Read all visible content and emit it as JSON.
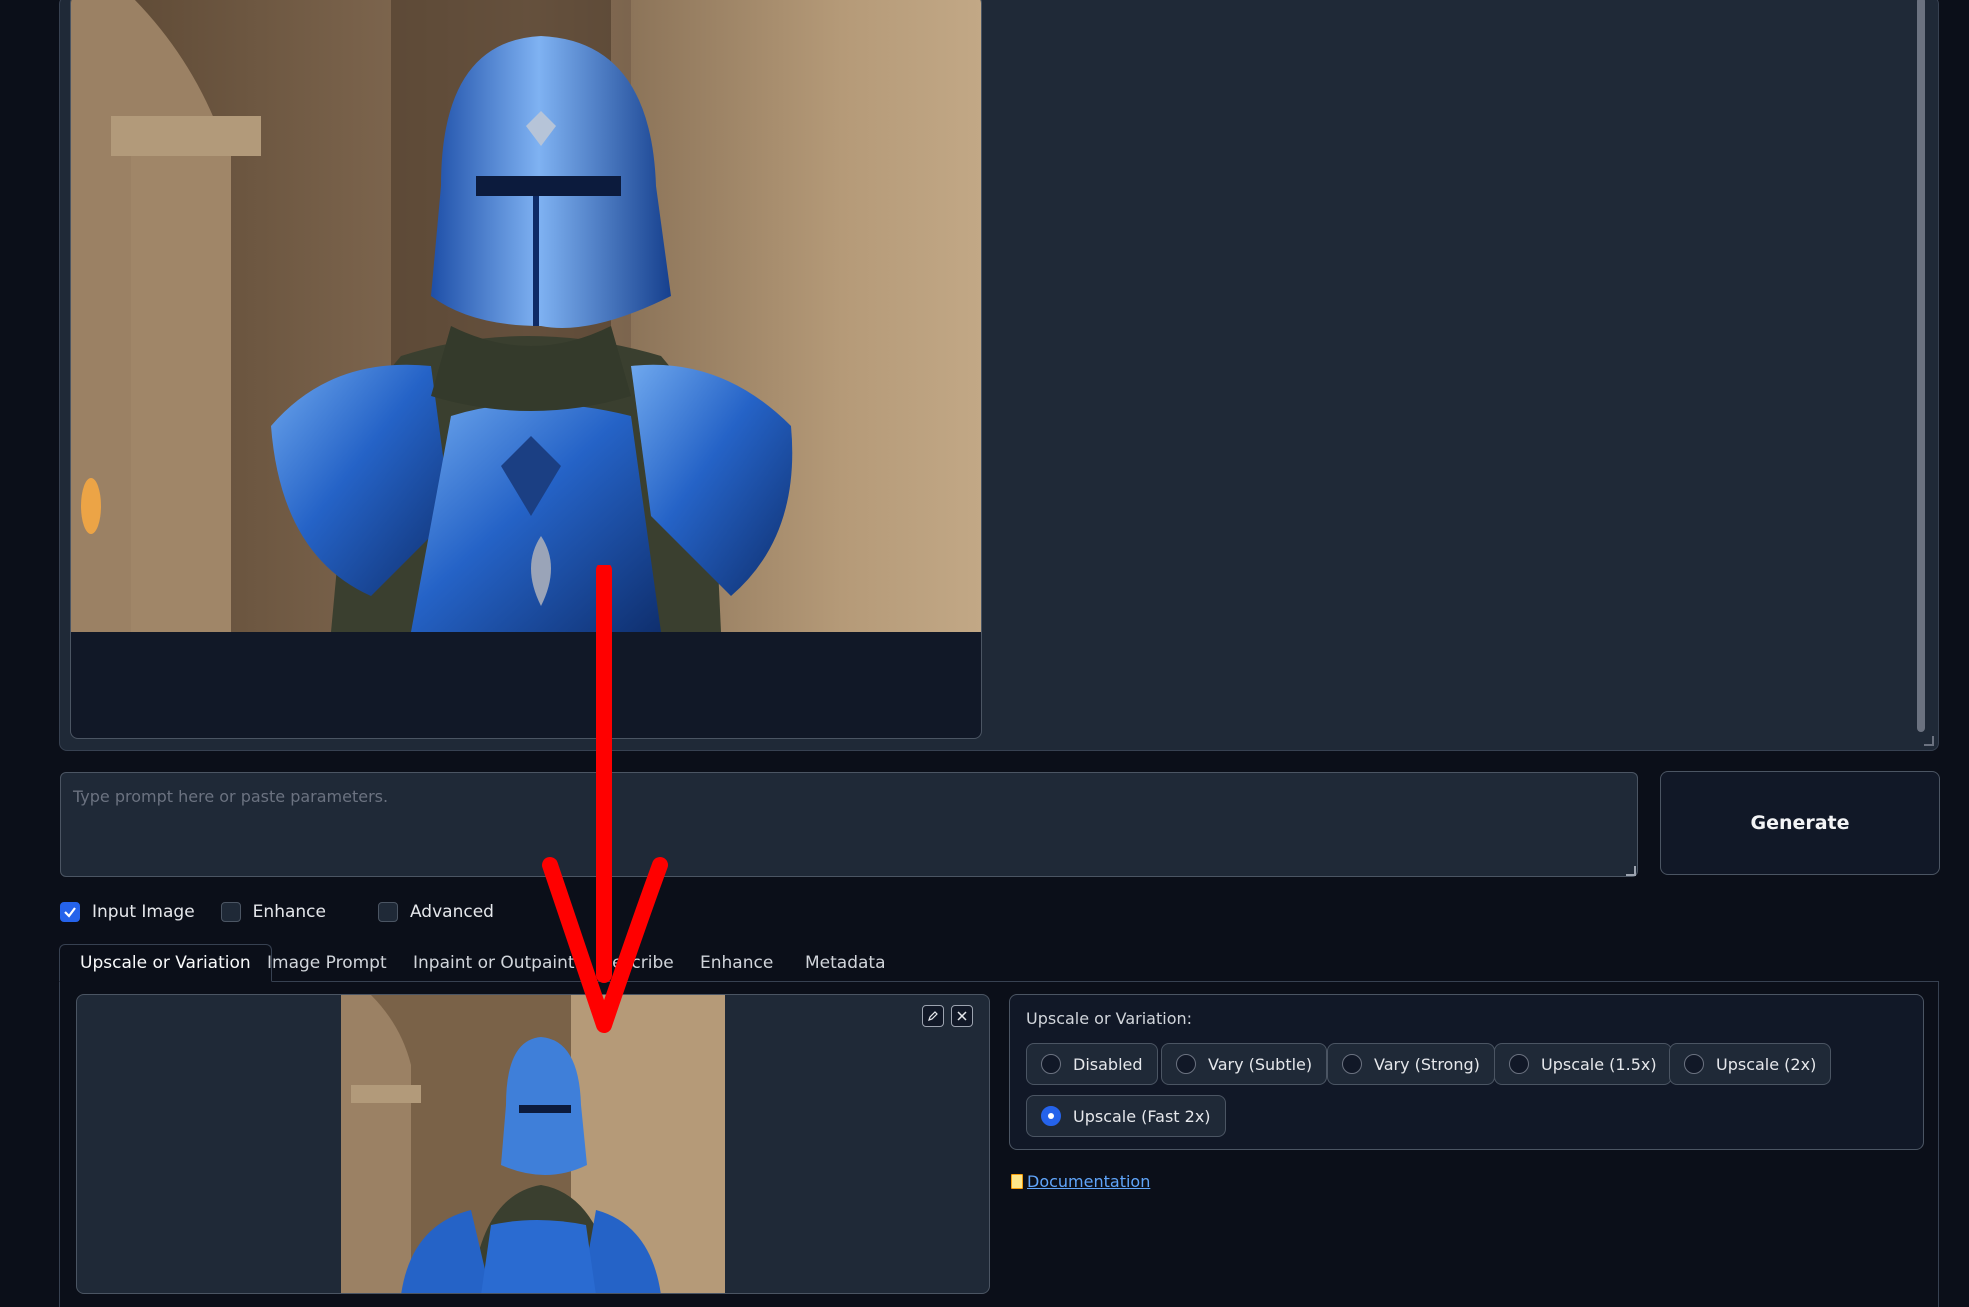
{
  "prompt": {
    "placeholder": "Type prompt here or paste parameters.",
    "value": ""
  },
  "generate": {
    "label": "Generate"
  },
  "options": [
    {
      "label": "Input Image",
      "checked": true
    },
    {
      "label": "Enhance",
      "checked": false
    },
    {
      "label": "Advanced",
      "checked": false
    }
  ],
  "tabs": [
    {
      "label": "Upscale or Variation",
      "active": true
    },
    {
      "label": "Image Prompt",
      "active": false
    },
    {
      "label": "Inpaint or Outpaint",
      "active": false
    },
    {
      "label": "Describe",
      "active": false
    },
    {
      "label": "Enhance",
      "active": false
    },
    {
      "label": "Metadata",
      "active": false
    }
  ],
  "variation": {
    "title": "Upscale or Variation:",
    "choices": [
      {
        "label": "Disabled",
        "selected": false
      },
      {
        "label": "Vary (Subtle)",
        "selected": false
      },
      {
        "label": "Vary (Strong)",
        "selected": false
      },
      {
        "label": "Upscale (1.5x)",
        "selected": false
      },
      {
        "label": "Upscale (2x)",
        "selected": false
      },
      {
        "label": "Upscale (Fast 2x)",
        "selected": true
      }
    ]
  },
  "documentation": {
    "label": " Documentation"
  },
  "colors": {
    "accent": "#2563eb",
    "annotation": "#ff0000",
    "armor": "#2563c7",
    "wall": "#b59a78"
  },
  "icons": {
    "edit": "pencil-icon",
    "clear": "close-icon",
    "doc": "document-icon"
  }
}
